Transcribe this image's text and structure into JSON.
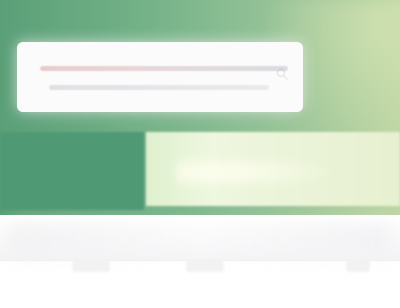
{
  "search": {
    "placeholder": ""
  },
  "colors": {
    "hero_start": "#5a9f78",
    "hero_mid": "#73b187",
    "hero_end": "#bfd6a4",
    "left_panel": "#4f9975",
    "promo_panel": "#dff0cf",
    "search_card": "#fbfbfb",
    "footer": "#ffffff"
  },
  "icons": {
    "search": "search-icon"
  }
}
